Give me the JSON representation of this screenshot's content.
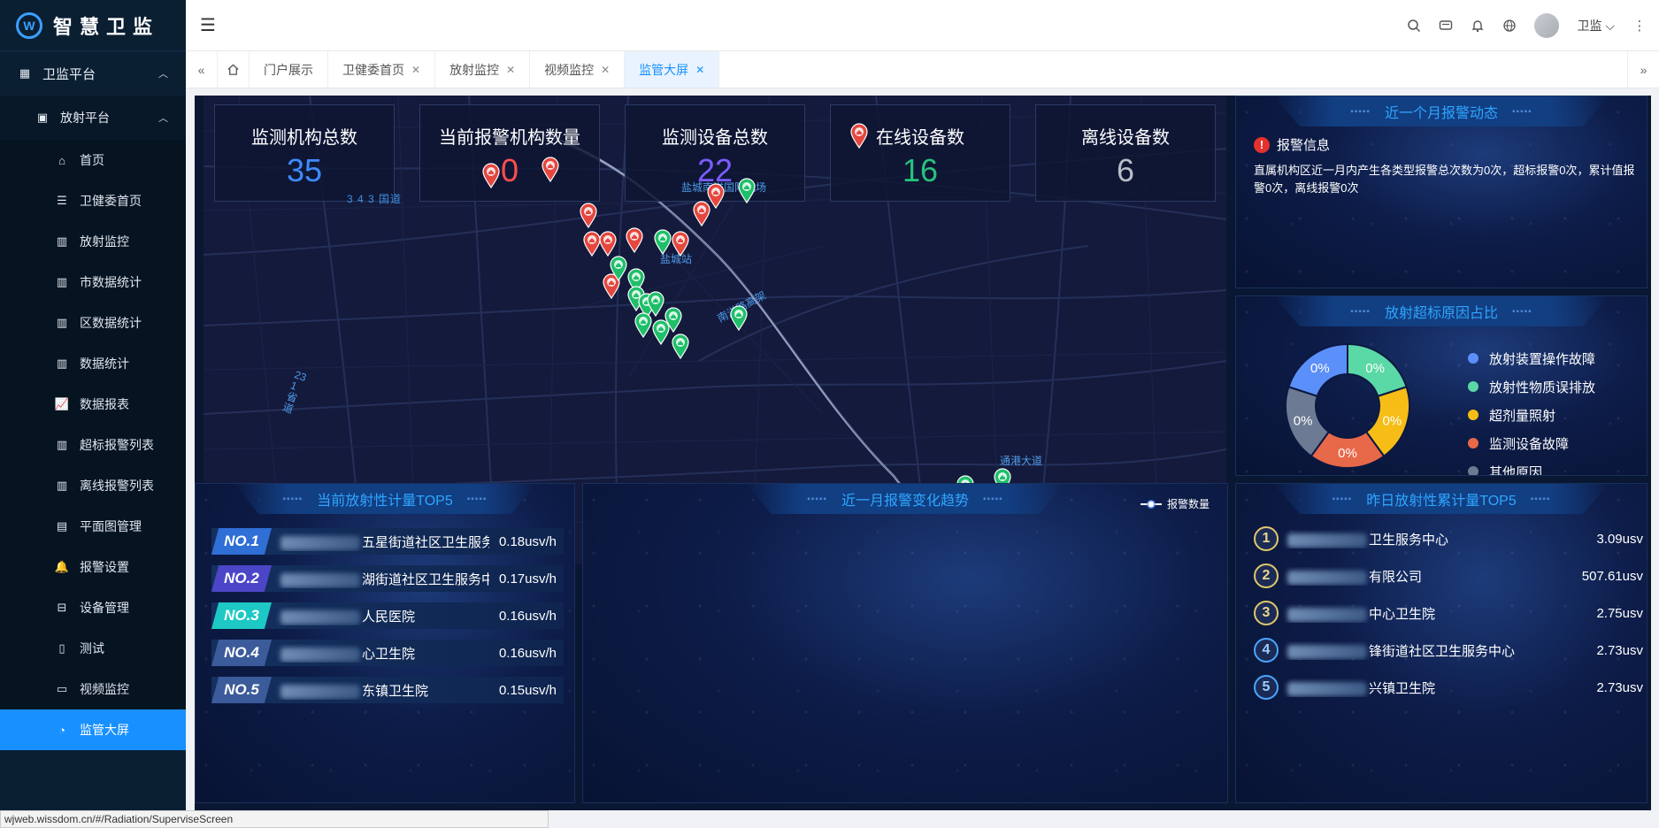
{
  "app": {
    "title": "智慧卫监",
    "logo_letter": "W"
  },
  "sidebar": {
    "l1": {
      "label": "卫监平台"
    },
    "l2": {
      "label": "放射平台"
    },
    "items": [
      {
        "label": "首页",
        "icon": "home-icon"
      },
      {
        "label": "卫健委首页",
        "icon": "list-icon"
      },
      {
        "label": "放射监控",
        "icon": "bar-chart-icon"
      },
      {
        "label": "市数据统计",
        "icon": "bar-chart-icon"
      },
      {
        "label": "区数据统计",
        "icon": "bar-chart-icon"
      },
      {
        "label": "数据统计",
        "icon": "bar-chart-icon"
      },
      {
        "label": "数据报表",
        "icon": "line-chart-icon"
      },
      {
        "label": "超标报警列表",
        "icon": "bar-chart-icon"
      },
      {
        "label": "离线报警列表",
        "icon": "bar-chart-icon"
      },
      {
        "label": "平面图管理",
        "icon": "floorplan-icon"
      },
      {
        "label": "报警设置",
        "icon": "bell-icon"
      },
      {
        "label": "设备管理",
        "icon": "device-icon"
      },
      {
        "label": "测试",
        "icon": "document-icon"
      },
      {
        "label": "视频监控",
        "icon": "video-icon"
      },
      {
        "label": "监管大屏",
        "icon": "pie-chart-icon"
      }
    ]
  },
  "header": {
    "user": "卫监"
  },
  "tabs": [
    {
      "label": "门户展示",
      "closable": false
    },
    {
      "label": "卫健委首页",
      "closable": true
    },
    {
      "label": "放射监控",
      "closable": true
    },
    {
      "label": "视频监控",
      "closable": true
    },
    {
      "label": "监管大屏",
      "closable": true,
      "active": true
    }
  ],
  "stats": [
    {
      "label": "监测机构总数",
      "value": "35",
      "color": "#3d8bff"
    },
    {
      "label": "当前报警机构数量",
      "value": "0",
      "color": "#ff4d4f"
    },
    {
      "label": "监测设备总数",
      "value": "22",
      "color": "#7b5cff"
    },
    {
      "label": "在线设备数",
      "value": "16",
      "color": "#27c27c"
    },
    {
      "label": "离线设备数",
      "value": "6",
      "color": "#b9bdc6"
    }
  ],
  "map_labels": {
    "road_343": "3 4 3 国道",
    "airport": "盐城南洋国际机场",
    "station": "盐城站",
    "expressway": "南洋路高架",
    "road_west": "231省道",
    "harbor": "通港大道"
  },
  "alarm_panel": {
    "title": "近一个月报警动态",
    "heading": "报警信息",
    "body": "直属机构区近一月内产生各类型报警总次数为0次，超标报警0次，累计值报警0次，离线报警0次"
  },
  "reason_panel": {
    "title": "放射超标原因占比",
    "items": [
      {
        "label": "放射装置操作故障",
        "value": "0%",
        "color": "#5b8ff9"
      },
      {
        "label": "放射性物质误排放",
        "value": "0%",
        "color": "#5ad8a6"
      },
      {
        "label": "超剂量照射",
        "value": "0%",
        "color": "#f6bd16"
      },
      {
        "label": "监测设备故障",
        "value": "0%",
        "color": "#e8684a"
      },
      {
        "label": "其他原因",
        "value": "0%",
        "color": "#6d7a94"
      }
    ]
  },
  "current_top5": {
    "title": "当前放射性计量TOP5",
    "rows": [
      {
        "rank": "NO.1",
        "name": "五星街道社区卫生服务中心",
        "value": "0.18usv/h",
        "color": "#2f6fd6"
      },
      {
        "rank": "NO.2",
        "name": "湖街道社区卫生服务中心",
        "value": "0.17usv/h",
        "color": "#4b46c8"
      },
      {
        "rank": "NO.3",
        "name": "人民医院",
        "value": "0.16usv/h",
        "color": "#1ec8c4"
      },
      {
        "rank": "NO.4",
        "name": "心卫生院",
        "value": "0.16usv/h",
        "color": "#3b5b9a"
      },
      {
        "rank": "NO.5",
        "name": "东镇卫生院",
        "value": "0.15usv/h",
        "color": "#3b5b9a"
      }
    ]
  },
  "trend_panel": {
    "title": "近一月报警变化趋势",
    "legend": "报警数量"
  },
  "yesterday_top5": {
    "title": "昨日放射性累计量TOP5",
    "rows": [
      {
        "rank": "1",
        "name": "卫生服务中心",
        "value": "3.09usv"
      },
      {
        "rank": "2",
        "name": "有限公司",
        "value": "507.61usv"
      },
      {
        "rank": "3",
        "name": "中心卫生院",
        "value": "2.75usv"
      },
      {
        "rank": "4",
        "name": "锋街道社区卫生服务中心",
        "value": "2.73usv"
      },
      {
        "rank": "5",
        "name": "兴镇卫生院",
        "value": "2.73usv"
      }
    ]
  },
  "statusbar": {
    "url": "wjweb.wissdom.cn/#/Radiation/SuperviseScreen"
  }
}
